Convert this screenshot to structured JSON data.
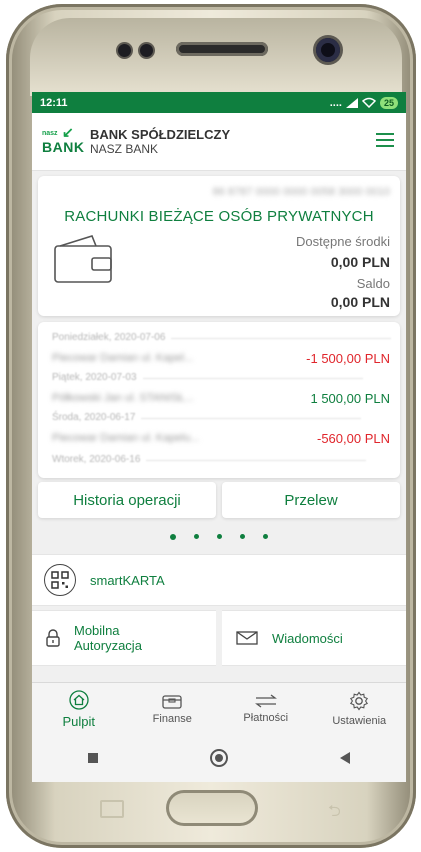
{
  "status_bar": {
    "time": "12:11",
    "signal_text": "....",
    "battery": "25"
  },
  "header": {
    "logo_small": "nasz",
    "logo_big": "BANK",
    "bank_title": "BANK SPÓŁDZIELCZY",
    "bank_subtitle": "NASZ BANK"
  },
  "account": {
    "number": "86 8787 0000 0000 0058 3000 0010",
    "name": "RACHUNKI BIEŻĄCE OSÓB PRYWATNYCH",
    "available_label": "Dostępne środki",
    "available_value": "0,00 PLN",
    "saldo_label": "Saldo",
    "saldo_value": "0,00 PLN"
  },
  "transactions": [
    {
      "date": "Poniedziałek, 2020-07-06",
      "desc": "Piecowar Damian ul. Kapel...",
      "amount": "-1 500,00 PLN"
    },
    {
      "date": "Piątek, 2020-07-03",
      "desc": "Półkowski Jan ul. STANISŁ...",
      "amount": "1 500,00 PLN"
    },
    {
      "date": "Środa, 2020-06-17",
      "desc": "Piecowar Damian ul. Kapelu...",
      "amount": "-560,00 PLN"
    },
    {
      "date": "Wtorek, 2020-06-16",
      "desc": "",
      "amount": ""
    }
  ],
  "buttons": {
    "history": "Historia operacji",
    "transfer": "Przelew"
  },
  "quick": {
    "smartkarta": "smartKARTA",
    "mobile_auth": "Mobilna Autoryzacja",
    "messages": "Wiadomości"
  },
  "tabs": [
    {
      "label": "Pulpit",
      "icon": "home-icon"
    },
    {
      "label": "Finanse",
      "icon": "wallet-icon"
    },
    {
      "label": "Płatności",
      "icon": "transfer-arrows-icon"
    },
    {
      "label": "Ustawienia",
      "icon": "gear-icon"
    }
  ],
  "colors": {
    "brand": "#0f7f3f",
    "negative": "#e0262c"
  }
}
